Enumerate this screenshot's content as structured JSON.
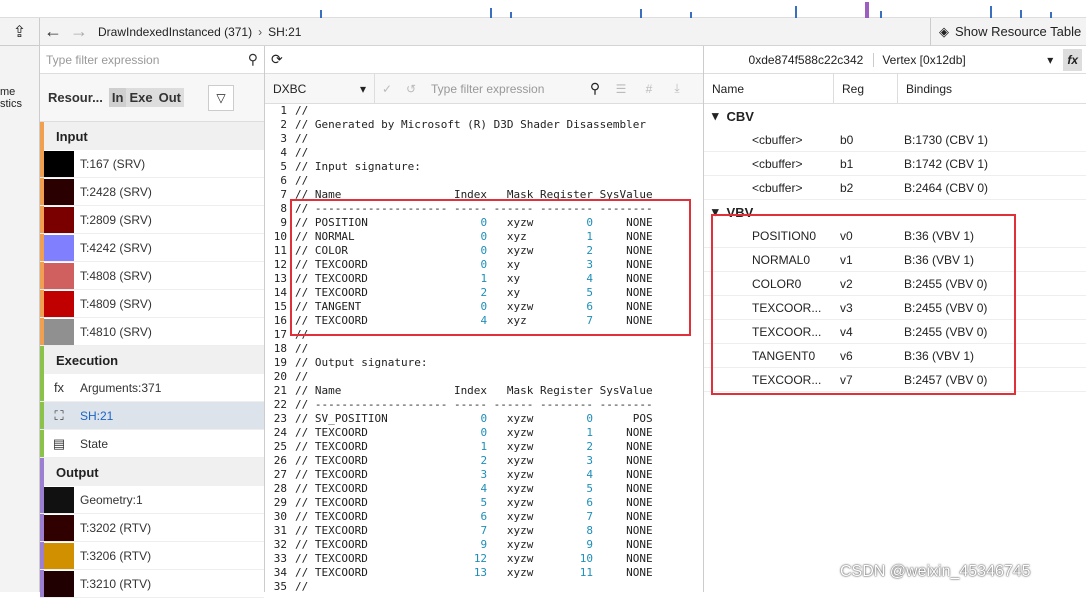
{
  "breadcrumb": {
    "back": "←",
    "forward": "→",
    "call": "DrawIndexedInstanced (371)",
    "shader": "SH:21"
  },
  "show_resource": "Show Resource Table",
  "left_edge": {
    "line1": "me",
    "line2": "stics"
  },
  "left": {
    "filter_placeholder": "Type filter expression",
    "resources_label": "Resour...",
    "seg": [
      "In",
      "Exe",
      "Out"
    ],
    "input_title": "Input",
    "inputs": [
      {
        "label": "T:167 (SRV)",
        "color": "#000000"
      },
      {
        "label": "T:2428 (SRV)",
        "color": "#2a0000"
      },
      {
        "label": "T:2809 (SRV)",
        "color": "#7a0000"
      },
      {
        "label": "T:4242 (SRV)",
        "color": "#8080ff"
      },
      {
        "label": "T:4808 (SRV)",
        "color": "#d06060"
      },
      {
        "label": "T:4809 (SRV)",
        "color": "#c00000"
      },
      {
        "label": "T:4810 (SRV)",
        "color": "#909090"
      }
    ],
    "execution_title": "Execution",
    "exec": [
      {
        "label": "Arguments:371",
        "icon": "fx"
      },
      {
        "label": "SH:21",
        "icon": "⛶"
      },
      {
        "label": "State",
        "icon": "▤"
      }
    ],
    "output_title": "Output",
    "outputs": [
      {
        "label": "Geometry:1",
        "color": "#111111"
      },
      {
        "label": "T:3202 (RTV)",
        "color": "#300000"
      },
      {
        "label": "T:3206 (RTV)",
        "color": "#d09000"
      },
      {
        "label": "T:3210 (RTV)",
        "color": "#200000"
      }
    ]
  },
  "mid": {
    "format": "DXBC",
    "filter_placeholder": "Type filter expression",
    "lines": [
      "//",
      "// Generated by Microsoft (R) D3D Shader Disassembler",
      "//",
      "//",
      "// Input signature:",
      "//",
      "// Name                 Index   Mask Register SysValue",
      "// -------------------- ----- ------ -------- --------",
      "// POSITION                 0   xyzw        0     NONE",
      "// NORMAL                   0   xyz         1     NONE",
      "// COLOR                    0   xyzw        2     NONE",
      "// TEXCOORD                 0   xy          3     NONE",
      "// TEXCOORD                 1   xy          4     NONE",
      "// TEXCOORD                 2   xy          5     NONE",
      "// TANGENT                  0   xyzw        6     NONE",
      "// TEXCOORD                 4   xyz         7     NONE",
      "//",
      "//",
      "// Output signature:",
      "//",
      "// Name                 Index   Mask Register SysValue",
      "// -------------------- ----- ------ -------- --------",
      "// SV_POSITION              0   xyzw        0      POS",
      "// TEXCOORD                 0   xyzw        1     NONE",
      "// TEXCOORD                 1   xyzw        2     NONE",
      "// TEXCOORD                 2   xyzw        3     NONE",
      "// TEXCOORD                 3   xyzw        4     NONE",
      "// TEXCOORD                 4   xyzw        5     NONE",
      "// TEXCOORD                 5   xyzw        6     NONE",
      "// TEXCOORD                 6   xyzw        7     NONE",
      "// TEXCOORD                 7   xyzw        8     NONE",
      "// TEXCOORD                 9   xyzw        9     NONE",
      "// TEXCOORD                12   xyzw       10     NONE",
      "// TEXCOORD                13   xyzw       11     NONE",
      "//"
    ]
  },
  "right": {
    "hash": "0xde874f588c22c342",
    "stage": "Vertex [0x12db]",
    "fx": "fx",
    "cols": [
      "Name",
      "Reg",
      "Bindings"
    ],
    "cbv_title": "CBV",
    "cbv": [
      {
        "name": "<cbuffer>",
        "reg": "b0",
        "bind": "B:1730 (CBV 1)"
      },
      {
        "name": "<cbuffer>",
        "reg": "b1",
        "bind": "B:1742 (CBV 1)"
      },
      {
        "name": "<cbuffer>",
        "reg": "b2",
        "bind": "B:2464 (CBV 0)"
      }
    ],
    "vbv_title": "VBV",
    "vbv": [
      {
        "name": "POSITION0",
        "reg": "v0",
        "bind": "B:36 (VBV 1)"
      },
      {
        "name": "NORMAL0",
        "reg": "v1",
        "bind": "B:36 (VBV 1)"
      },
      {
        "name": "COLOR0",
        "reg": "v2",
        "bind": "B:2455 (VBV 0)"
      },
      {
        "name": "TEXCOOR...",
        "reg": "v3",
        "bind": "B:2455 (VBV 0)"
      },
      {
        "name": "TEXCOOR...",
        "reg": "v4",
        "bind": "B:2455 (VBV 0)"
      },
      {
        "name": "TANGENT0",
        "reg": "v6",
        "bind": "B:36 (VBV 1)"
      },
      {
        "name": "TEXCOOR...",
        "reg": "v7",
        "bind": "B:2457 (VBV 0)"
      }
    ]
  },
  "watermark": "CSDN @weixin_45346745",
  "colors": {
    "accent_input": "#f0a050",
    "accent_exec": "#8bc34a",
    "accent_output": "#9c7fd0",
    "highlight": "#e0313b",
    "number": "#1e8eb8"
  }
}
